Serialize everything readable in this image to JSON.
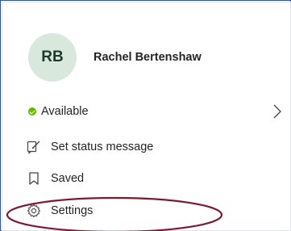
{
  "profile": {
    "initials": "RB",
    "name": "Rachel Bertenshaw"
  },
  "menu": {
    "available_label": "Available",
    "status_message_label": "Set status message",
    "saved_label": "Saved",
    "settings_label": "Settings"
  },
  "colors": {
    "frame_border": "#2f5597",
    "avatar_bg": "#d9e8dd",
    "available_green": "#6bb700",
    "highlight_ellipse": "#7b1a33"
  },
  "icons": {
    "status": "available-check-icon",
    "status_message": "edit-status-icon",
    "saved": "bookmark-icon",
    "settings": "gear-icon",
    "expand": "chevron-right-icon"
  }
}
